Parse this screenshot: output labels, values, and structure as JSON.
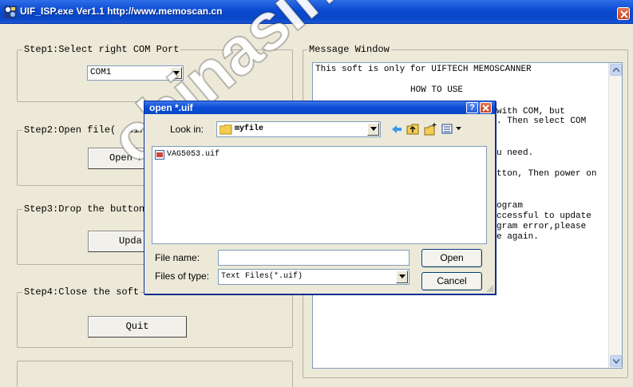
{
  "window": {
    "title": "UIF_ISP.exe Ver1.1 http://www.memoscan.cn"
  },
  "step1": {
    "label": "Step1:Select right COM Port",
    "com_port_value": "COM1"
  },
  "step2": {
    "label": "Step2:Open file( .uif",
    "button_label": "Open F"
  },
  "step3": {
    "label": "Step3:Drop the button",
    "button_label": "Upda"
  },
  "step4": {
    "label": "Step4:Close the soft",
    "button_label": "Quit"
  },
  "message_window": {
    "label": "Message Window",
    "lines": [
      "This soft is only for UIFTECH MEMOSCANNER",
      "HOW TO USE",
      "with COM, but",
      ". Then select COM",
      "u need.",
      "tton, Then power on",
      "ogram",
      "ccessful to update",
      "gram error,please",
      "e again."
    ]
  },
  "dialog": {
    "title": "open *.uif",
    "help_label": "?",
    "look_in_label": "Look in:",
    "look_in_value": "myfile",
    "files": [
      "VAG5053.uif"
    ],
    "file_name_label": "File name:",
    "file_name_value": "",
    "files_of_type_label": "Files of type:",
    "files_of_type_value": "Text Files(*.uif)",
    "open_button": "Open",
    "cancel_button": "Cancel"
  },
  "watermark": {
    "text": "chinasino"
  },
  "colors": {
    "titlebar": "#0a4ad0",
    "window_bg": "#ece9d8",
    "close_button": "#c6431e"
  }
}
